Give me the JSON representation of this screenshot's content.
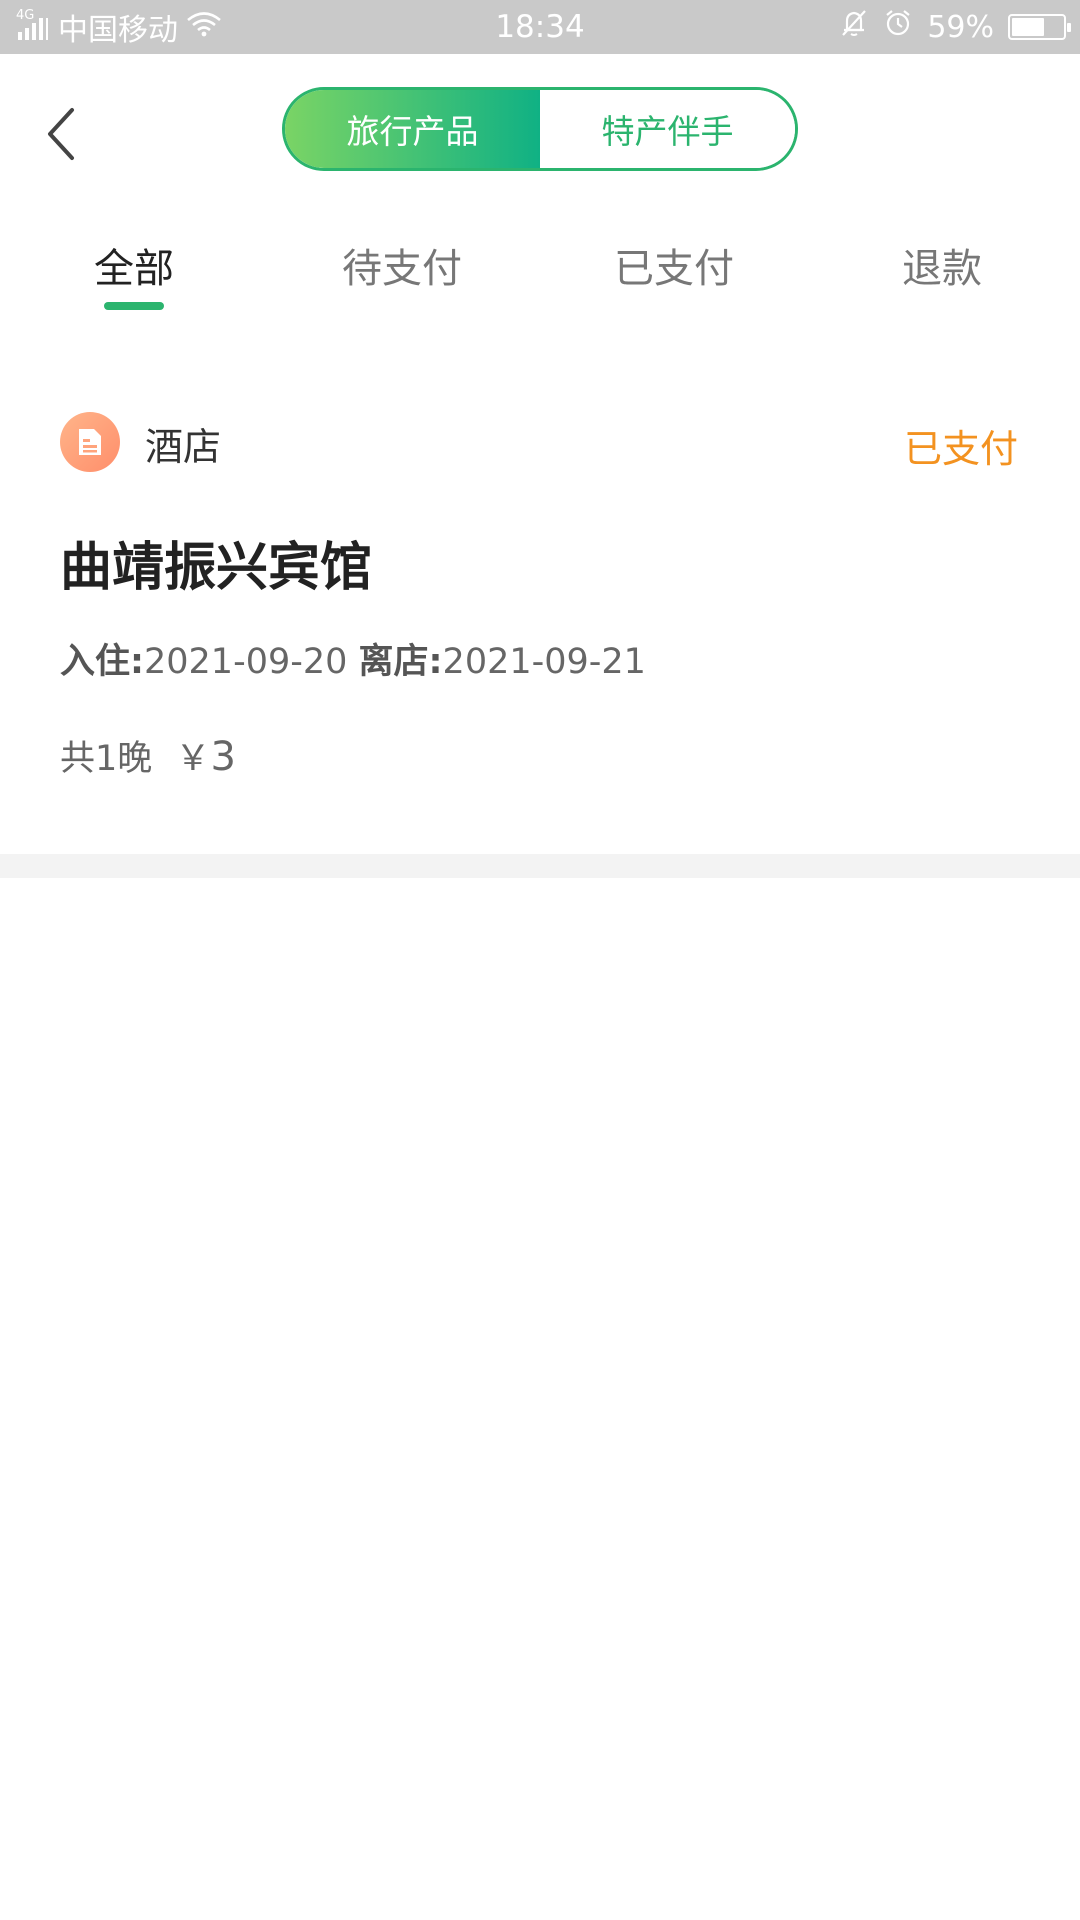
{
  "status_bar": {
    "network": "4G",
    "carrier": "中国移动",
    "time": "18:34",
    "battery_percent_text": "59%",
    "battery_level": 0.59,
    "icons": [
      "signal-icon",
      "wifi-icon",
      "bell-muted-icon",
      "alarm-icon",
      "battery-icon"
    ]
  },
  "header": {
    "segments": [
      {
        "label": "旅行产品",
        "active": true
      },
      {
        "label": "特产伴手",
        "active": false
      }
    ],
    "accent_color": "#2bb46e"
  },
  "tabs": [
    {
      "label": "全部",
      "active": true
    },
    {
      "label": "待支付",
      "active": false
    },
    {
      "label": "已支付",
      "active": false
    },
    {
      "label": "退款",
      "active": false
    }
  ],
  "orders": [
    {
      "category": "酒店",
      "status": "已支付",
      "status_color": "#f39220",
      "name": "曲靖振兴宾馆",
      "checkin_label": "入住:",
      "checkin_date": "2021-09-20",
      "checkout_label": "离店:",
      "checkout_date": "2021-09-21",
      "nights_text": "共1晚",
      "price_symbol": "￥",
      "price": "3"
    }
  ]
}
